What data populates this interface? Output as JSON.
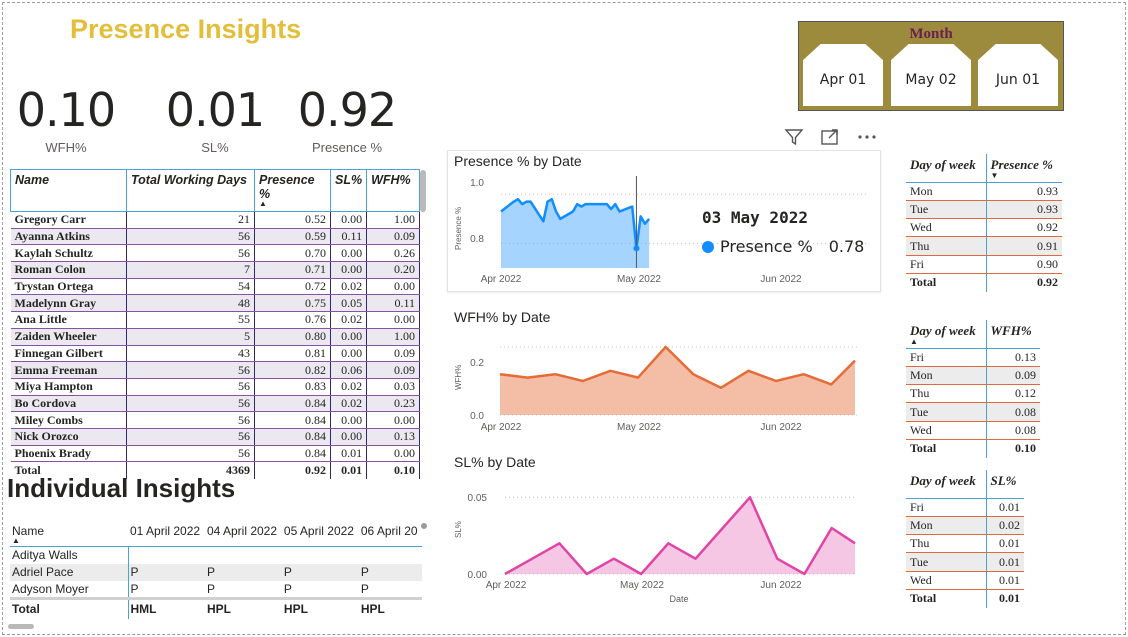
{
  "title": "Presence Insights",
  "kpis": [
    {
      "value": "0.10",
      "label": "WFH%"
    },
    {
      "value": "0.01",
      "label": "SL%"
    },
    {
      "value": "0.92",
      "label": "Presence %"
    }
  ],
  "month_slicer": {
    "header": "Month",
    "options": [
      "Apr 01",
      "May 02",
      "Jun 01"
    ]
  },
  "main_table": {
    "columns": [
      "Name",
      "Total Working Days",
      "Presence %",
      "SL%",
      "WFH%"
    ],
    "rows": [
      [
        "Gregory Carr",
        "21",
        "0.52",
        "0.00",
        "1.00"
      ],
      [
        "Ayanna Atkins",
        "56",
        "0.59",
        "0.11",
        "0.09"
      ],
      [
        "Kaylah Schultz",
        "56",
        "0.70",
        "0.00",
        "0.26"
      ],
      [
        "Roman Colon",
        "7",
        "0.71",
        "0.00",
        "0.20"
      ],
      [
        "Trystan Ortega",
        "54",
        "0.72",
        "0.02",
        "0.00"
      ],
      [
        "Madelynn Gray",
        "48",
        "0.75",
        "0.05",
        "0.11"
      ],
      [
        "Ana Little",
        "55",
        "0.76",
        "0.02",
        "0.00"
      ],
      [
        "Zaiden Wheeler",
        "5",
        "0.80",
        "0.00",
        "1.00"
      ],
      [
        "Finnegan Gilbert",
        "43",
        "0.81",
        "0.00",
        "0.09"
      ],
      [
        "Emma Freeman",
        "56",
        "0.82",
        "0.06",
        "0.09"
      ],
      [
        "Miya Hampton",
        "56",
        "0.83",
        "0.02",
        "0.03"
      ],
      [
        "Bo Cordova",
        "56",
        "0.84",
        "0.02",
        "0.23"
      ],
      [
        "Miley Combs",
        "56",
        "0.84",
        "0.00",
        "0.00"
      ],
      [
        "Nick Orozco",
        "56",
        "0.84",
        "0.00",
        "0.13"
      ],
      [
        "Phoenix Brady",
        "56",
        "0.84",
        "0.01",
        "0.00"
      ]
    ],
    "total": [
      "Total",
      "4369",
      "0.92",
      "0.01",
      "0.10"
    ]
  },
  "individual": {
    "section_title": "Individual Insights",
    "columns": [
      "Name",
      "01 April 2022",
      "04 April 2022",
      "05 April 2022",
      "06 April 20"
    ],
    "rows": [
      [
        "Aditya Walls",
        "",
        "",
        "",
        ""
      ],
      [
        "Adriel Pace",
        "P",
        "P",
        "P",
        "P"
      ],
      [
        "Adyson Moyer",
        "P",
        "P",
        "P",
        "P"
      ]
    ],
    "total": [
      "Total",
      "HML",
      "HPL",
      "HPL",
      "HPL"
    ]
  },
  "icons": {
    "filter": "filter-icon",
    "focus": "focus-mode-icon",
    "more": "more-options-icon"
  },
  "presence_chart": {
    "title": "Presence % by Date",
    "ylabel": "Presence %",
    "x_ticks": [
      "Apr 2022",
      "May 2022",
      "Jun 2022"
    ],
    "y_ticks": [
      "1.0",
      "0.8"
    ],
    "color": "#118DFF",
    "tooltip": {
      "date": "03 May 2022",
      "series": "Presence %",
      "value": "0.78"
    }
  },
  "wfh_chart": {
    "title": "WFH% by Date",
    "ylabel": "WFH%",
    "x_ticks": [
      "Apr 2022",
      "May 2022",
      "Jun 2022"
    ],
    "y_ticks": [
      "0.2",
      "0.0"
    ],
    "color": "#E66C37"
  },
  "sl_chart": {
    "title": "SL% by Date",
    "ylabel": "SL%",
    "xlabel": "Date",
    "x_ticks": [
      "Apr 2022",
      "May 2022",
      "Jun 2022"
    ],
    "y_ticks": [
      "0.05",
      "0.00"
    ],
    "color": "#E044A7"
  },
  "chart_data": [
    {
      "type": "area",
      "title": "Presence % by Date",
      "ylabel": "Presence %",
      "ylim": [
        0.7,
        1.05
      ],
      "x": [
        "2022-04-01",
        "2022-04-04",
        "2022-04-05",
        "2022-04-06",
        "2022-04-07",
        "2022-04-08",
        "2022-04-11",
        "2022-04-12",
        "2022-04-13",
        "2022-04-14",
        "2022-04-15",
        "2022-04-18",
        "2022-04-19",
        "2022-04-20",
        "2022-04-21",
        "2022-04-22",
        "2022-04-25",
        "2022-04-26",
        "2022-04-27",
        "2022-04-28",
        "2022-04-29",
        "2022-05-02",
        "2022-05-03",
        "2022-05-04",
        "2022-05-05",
        "2022-05-06"
      ],
      "series": [
        {
          "name": "Presence %",
          "values": [
            0.93,
            0.97,
            0.98,
            0.96,
            0.97,
            0.97,
            0.89,
            0.97,
            0.98,
            0.93,
            0.9,
            0.93,
            0.96,
            0.95,
            0.96,
            0.96,
            0.96,
            0.96,
            0.94,
            0.96,
            0.93,
            0.95,
            0.78,
            0.91,
            0.88,
            0.9
          ]
        }
      ]
    },
    {
      "type": "area",
      "title": "WFH% by Date",
      "ylabel": "WFH%",
      "ylim": [
        0,
        0.25
      ],
      "x": [
        "2022-04-01",
        "2022-04-08",
        "2022-04-15",
        "2022-04-22",
        "2022-04-29",
        "2022-05-06",
        "2022-05-13",
        "2022-05-20",
        "2022-05-27",
        "2022-06-03",
        "2022-06-10",
        "2022-06-17",
        "2022-06-24",
        "2022-06-30"
      ],
      "series": [
        {
          "name": "WFH%",
          "values": [
            0.12,
            0.11,
            0.12,
            0.1,
            0.13,
            0.11,
            0.2,
            0.12,
            0.08,
            0.13,
            0.1,
            0.12,
            0.09,
            0.16
          ]
        }
      ]
    },
    {
      "type": "area",
      "title": "SL% by Date",
      "xlabel": "Date",
      "ylabel": "SL%",
      "ylim": [
        0,
        0.06
      ],
      "x": [
        "2022-04-01",
        "2022-04-08",
        "2022-04-15",
        "2022-04-22",
        "2022-04-29",
        "2022-05-06",
        "2022-05-13",
        "2022-05-20",
        "2022-05-27",
        "2022-06-03",
        "2022-06-10",
        "2022-06-17",
        "2022-06-24",
        "2022-06-30"
      ],
      "series": [
        {
          "name": "SL%",
          "values": [
            0.0,
            0.01,
            0.02,
            0.0,
            0.01,
            0.0,
            0.02,
            0.01,
            0.03,
            0.05,
            0.01,
            0.0,
            0.03,
            0.02
          ]
        }
      ]
    }
  ],
  "dow_presence": {
    "columns": [
      "Day of week",
      "Presence %"
    ],
    "rows": [
      [
        "Mon",
        "0.93"
      ],
      [
        "Tue",
        "0.93"
      ],
      [
        "Wed",
        "0.92"
      ],
      [
        "Thu",
        "0.91"
      ],
      [
        "Fri",
        "0.90"
      ]
    ],
    "total": [
      "Total",
      "0.92"
    ]
  },
  "dow_wfh": {
    "columns": [
      "Day of week",
      "WFH%"
    ],
    "rows": [
      [
        "Fri",
        "0.13"
      ],
      [
        "Mon",
        "0.09"
      ],
      [
        "Thu",
        "0.12"
      ],
      [
        "Tue",
        "0.08"
      ],
      [
        "Wed",
        "0.08"
      ]
    ],
    "total": [
      "Total",
      "0.10"
    ]
  },
  "dow_sl": {
    "columns": [
      "Day of week",
      "SL%"
    ],
    "rows": [
      [
        "Fri",
        "0.01"
      ],
      [
        "Mon",
        "0.02"
      ],
      [
        "Thu",
        "0.01"
      ],
      [
        "Tue",
        "0.01"
      ],
      [
        "Wed",
        "0.01"
      ]
    ],
    "total": [
      "Total",
      "0.01"
    ]
  }
}
